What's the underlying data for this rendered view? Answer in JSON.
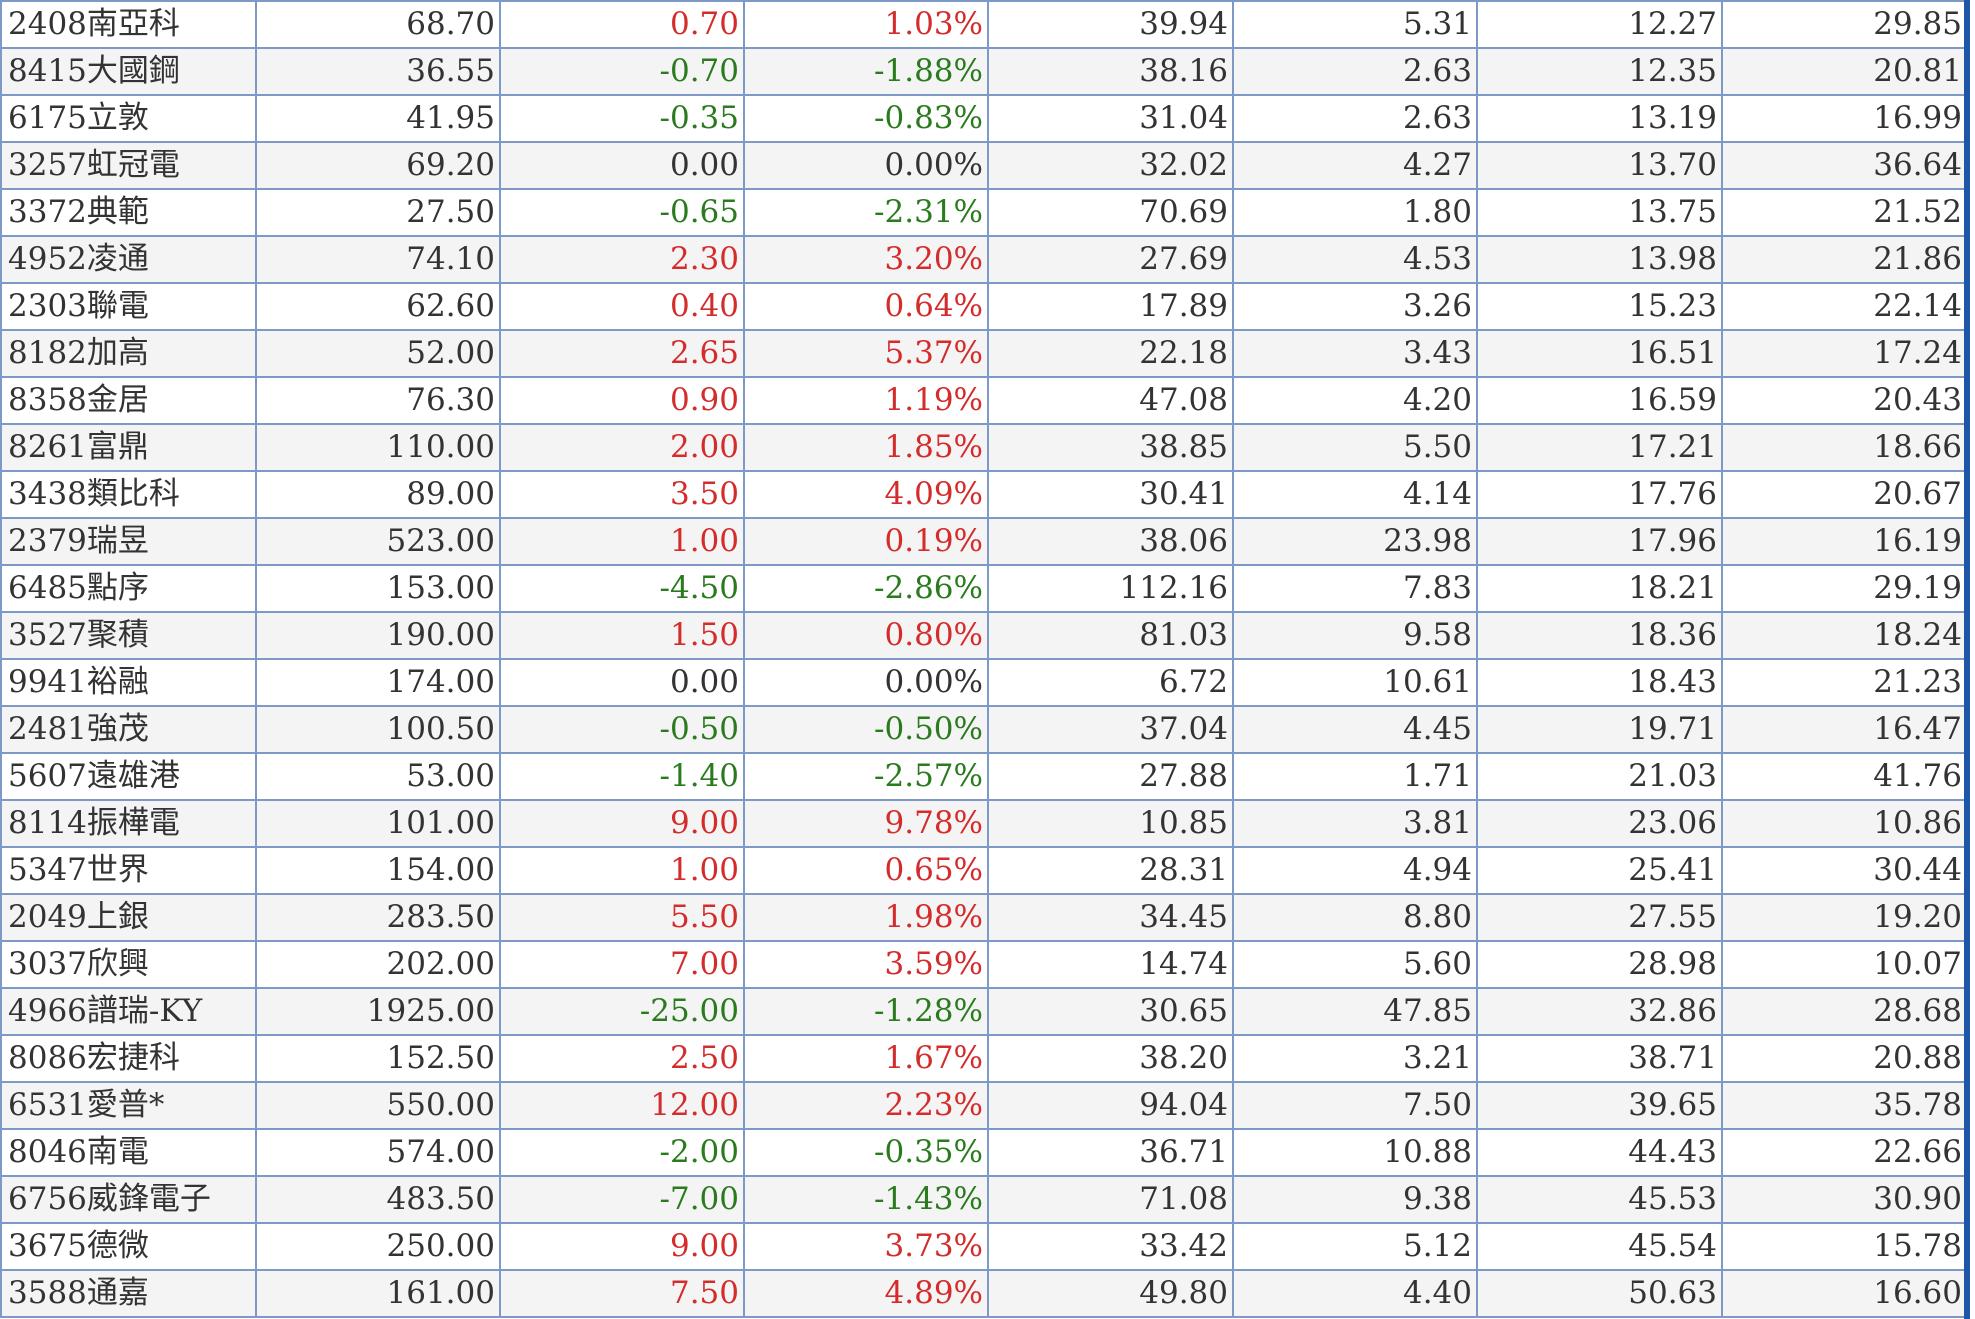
{
  "colors": {
    "up": "#d42b2b",
    "down": "#2a7a1e",
    "flat": "#333333",
    "grid": "#7f99c7",
    "frame": "#1e56a8"
  },
  "rows": [
    {
      "name": "2408南亞科",
      "price": "68.70",
      "change": "0.70",
      "pct": "1.03%",
      "c4": "39.94",
      "c5": "5.31",
      "c6": "12.27",
      "c7": "29.85",
      "dir": "up"
    },
    {
      "name": "8415大國鋼",
      "price": "36.55",
      "change": "-0.70",
      "pct": "-1.88%",
      "c4": "38.16",
      "c5": "2.63",
      "c6": "12.35",
      "c7": "20.81",
      "dir": "down"
    },
    {
      "name": "6175立敦",
      "price": "41.95",
      "change": "-0.35",
      "pct": "-0.83%",
      "c4": "31.04",
      "c5": "2.63",
      "c6": "13.19",
      "c7": "16.99",
      "dir": "down"
    },
    {
      "name": "3257虹冠電",
      "price": "69.20",
      "change": "0.00",
      "pct": "0.00%",
      "c4": "32.02",
      "c5": "4.27",
      "c6": "13.70",
      "c7": "36.64",
      "dir": "flat"
    },
    {
      "name": "3372典範",
      "price": "27.50",
      "change": "-0.65",
      "pct": "-2.31%",
      "c4": "70.69",
      "c5": "1.80",
      "c6": "13.75",
      "c7": "21.52",
      "dir": "down"
    },
    {
      "name": "4952凌通",
      "price": "74.10",
      "change": "2.30",
      "pct": "3.20%",
      "c4": "27.69",
      "c5": "4.53",
      "c6": "13.98",
      "c7": "21.86",
      "dir": "up"
    },
    {
      "name": "2303聯電",
      "price": "62.60",
      "change": "0.40",
      "pct": "0.64%",
      "c4": "17.89",
      "c5": "3.26",
      "c6": "15.23",
      "c7": "22.14",
      "dir": "up"
    },
    {
      "name": "8182加高",
      "price": "52.00",
      "change": "2.65",
      "pct": "5.37%",
      "c4": "22.18",
      "c5": "3.43",
      "c6": "16.51",
      "c7": "17.24",
      "dir": "up"
    },
    {
      "name": "8358金居",
      "price": "76.30",
      "change": "0.90",
      "pct": "1.19%",
      "c4": "47.08",
      "c5": "4.20",
      "c6": "16.59",
      "c7": "20.43",
      "dir": "up"
    },
    {
      "name": "8261富鼎",
      "price": "110.00",
      "change": "2.00",
      "pct": "1.85%",
      "c4": "38.85",
      "c5": "5.50",
      "c6": "17.21",
      "c7": "18.66",
      "dir": "up"
    },
    {
      "name": "3438類比科",
      "price": "89.00",
      "change": "3.50",
      "pct": "4.09%",
      "c4": "30.41",
      "c5": "4.14",
      "c6": "17.76",
      "c7": "20.67",
      "dir": "up"
    },
    {
      "name": "2379瑞昱",
      "price": "523.00",
      "change": "1.00",
      "pct": "0.19%",
      "c4": "38.06",
      "c5": "23.98",
      "c6": "17.96",
      "c7": "16.19",
      "dir": "up"
    },
    {
      "name": "6485點序",
      "price": "153.00",
      "change": "-4.50",
      "pct": "-2.86%",
      "c4": "112.16",
      "c5": "7.83",
      "c6": "18.21",
      "c7": "29.19",
      "dir": "down"
    },
    {
      "name": "3527聚積",
      "price": "190.00",
      "change": "1.50",
      "pct": "0.80%",
      "c4": "81.03",
      "c5": "9.58",
      "c6": "18.36",
      "c7": "18.24",
      "dir": "up"
    },
    {
      "name": "9941裕融",
      "price": "174.00",
      "change": "0.00",
      "pct": "0.00%",
      "c4": "6.72",
      "c5": "10.61",
      "c6": "18.43",
      "c7": "21.23",
      "dir": "flat"
    },
    {
      "name": "2481強茂",
      "price": "100.50",
      "change": "-0.50",
      "pct": "-0.50%",
      "c4": "37.04",
      "c5": "4.45",
      "c6": "19.71",
      "c7": "16.47",
      "dir": "down"
    },
    {
      "name": "5607遠雄港",
      "price": "53.00",
      "change": "-1.40",
      "pct": "-2.57%",
      "c4": "27.88",
      "c5": "1.71",
      "c6": "21.03",
      "c7": "41.76",
      "dir": "down"
    },
    {
      "name": "8114振樺電",
      "price": "101.00",
      "change": "9.00",
      "pct": "9.78%",
      "c4": "10.85",
      "c5": "3.81",
      "c6": "23.06",
      "c7": "10.86",
      "dir": "up"
    },
    {
      "name": "5347世界",
      "price": "154.00",
      "change": "1.00",
      "pct": "0.65%",
      "c4": "28.31",
      "c5": "4.94",
      "c6": "25.41",
      "c7": "30.44",
      "dir": "up"
    },
    {
      "name": "2049上銀",
      "price": "283.50",
      "change": "5.50",
      "pct": "1.98%",
      "c4": "34.45",
      "c5": "8.80",
      "c6": "27.55",
      "c7": "19.20",
      "dir": "up"
    },
    {
      "name": "3037欣興",
      "price": "202.00",
      "change": "7.00",
      "pct": "3.59%",
      "c4": "14.74",
      "c5": "5.60",
      "c6": "28.98",
      "c7": "10.07",
      "dir": "up"
    },
    {
      "name": "4966譜瑞-KY",
      "price": "1925.00",
      "change": "-25.00",
      "pct": "-1.28%",
      "c4": "30.65",
      "c5": "47.85",
      "c6": "32.86",
      "c7": "28.68",
      "dir": "down"
    },
    {
      "name": "8086宏捷科",
      "price": "152.50",
      "change": "2.50",
      "pct": "1.67%",
      "c4": "38.20",
      "c5": "3.21",
      "c6": "38.71",
      "c7": "20.88",
      "dir": "up"
    },
    {
      "name": "6531愛普*",
      "price": "550.00",
      "change": "12.00",
      "pct": "2.23%",
      "c4": "94.04",
      "c5": "7.50",
      "c6": "39.65",
      "c7": "35.78",
      "dir": "up"
    },
    {
      "name": "8046南電",
      "price": "574.00",
      "change": "-2.00",
      "pct": "-0.35%",
      "c4": "36.71",
      "c5": "10.88",
      "c6": "44.43",
      "c7": "22.66",
      "dir": "down"
    },
    {
      "name": "6756威鋒電子",
      "price": "483.50",
      "change": "-7.00",
      "pct": "-1.43%",
      "c4": "71.08",
      "c5": "9.38",
      "c6": "45.53",
      "c7": "30.90",
      "dir": "down"
    },
    {
      "name": "3675德微",
      "price": "250.00",
      "change": "9.00",
      "pct": "3.73%",
      "c4": "33.42",
      "c5": "5.12",
      "c6": "45.54",
      "c7": "15.78",
      "dir": "up"
    },
    {
      "name": "3588通嘉",
      "price": "161.00",
      "change": "7.50",
      "pct": "4.89%",
      "c4": "49.80",
      "c5": "4.40",
      "c6": "50.63",
      "c7": "16.60",
      "dir": "up"
    }
  ]
}
